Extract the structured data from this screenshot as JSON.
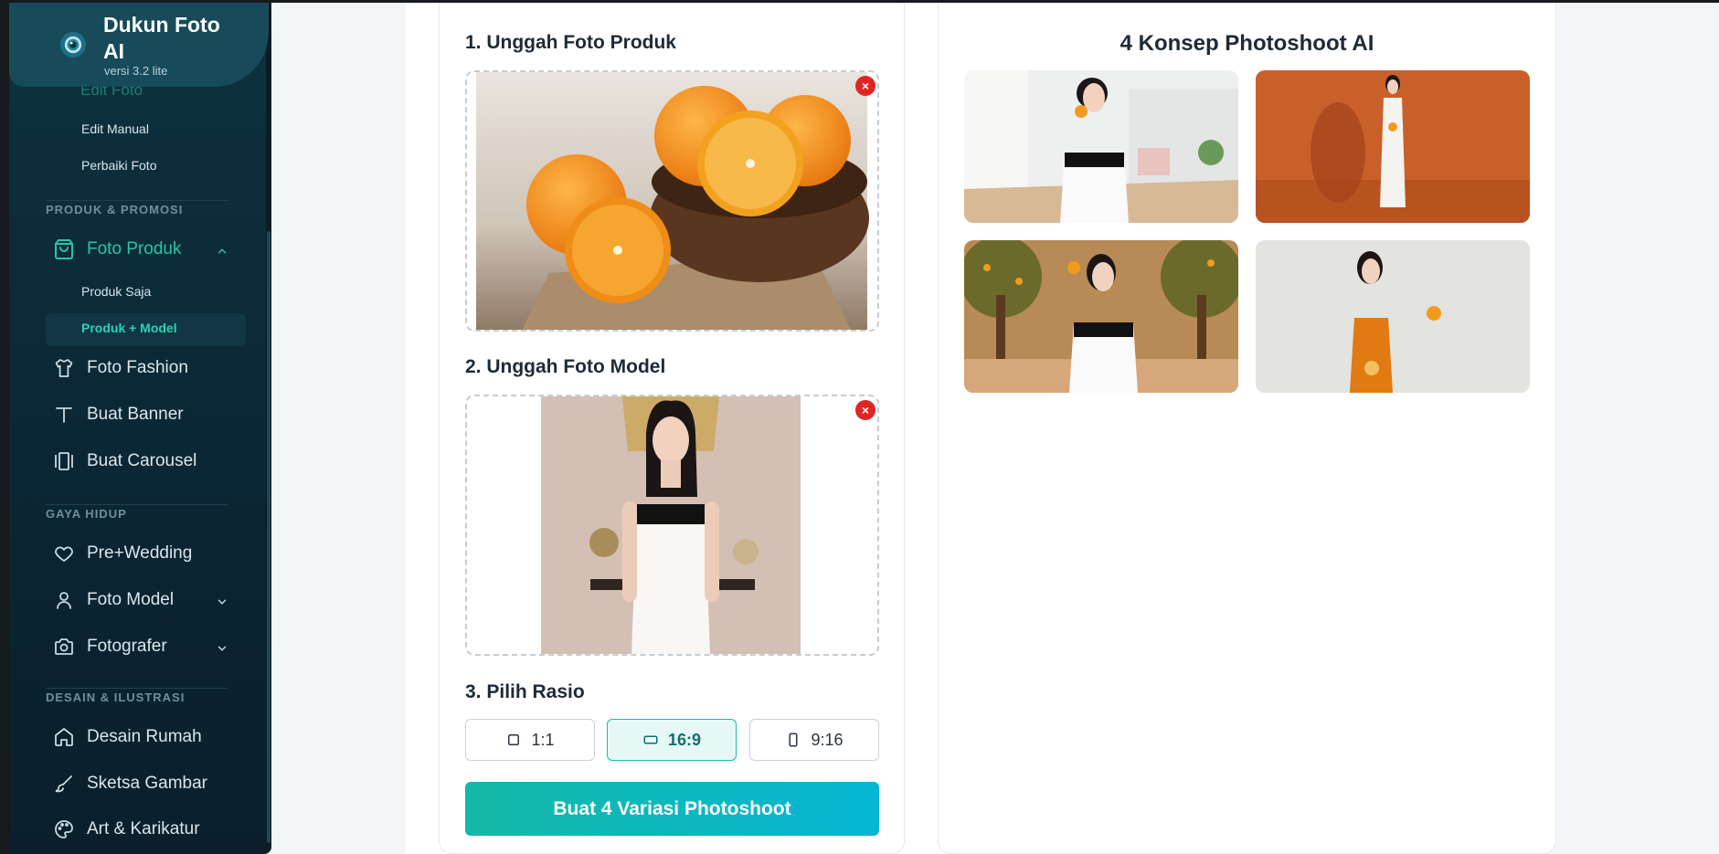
{
  "app": {
    "title": "Dukun Foto AI",
    "version": "versi 3.2 lite"
  },
  "sidebar": {
    "partial_item": "Edit Foto",
    "subs_top": [
      "Edit Manual",
      "Perbaiki Foto"
    ],
    "section_produk": "PRODUK & PROMOSI",
    "foto_produk": "Foto Produk",
    "foto_produk_subs": [
      "Produk Saja",
      "Produk + Model"
    ],
    "foto_fashion": "Foto Fashion",
    "buat_banner": "Buat Banner",
    "buat_carousel": "Buat Carousel",
    "section_gaya": "GAYA HIDUP",
    "prewedding": "Pre+Wedding",
    "foto_model": "Foto Model",
    "fotografer": "Fotografer",
    "section_desain": "DESAIN & ILUSTRASI",
    "desain_rumah": "Desain Rumah",
    "sketsa_gambar": "Sketsa Gambar",
    "art_karikatur": "Art & Karikatur"
  },
  "form": {
    "step1": "1. Unggah Foto Produk",
    "step2": "2. Unggah Foto Model",
    "step3": "3. Pilih Rasio",
    "remove_symbol": "×",
    "ratios": [
      "1:1",
      "16:9",
      "9:16"
    ],
    "selected_ratio": "16:9",
    "submit": "Buat 4 Variasi Photoshoot"
  },
  "results": {
    "title": "4 Konsep Photoshoot AI"
  },
  "colors": {
    "accent": "#14b8a6",
    "accent_end": "#06b6d4",
    "danger": "#e02424",
    "sidebar_bg": "#0b2533"
  },
  "icons": [
    "camera-lens-icon",
    "shopping-bag-icon",
    "chevron-up-icon",
    "shirt-icon",
    "text-t-icon",
    "carousel-icon",
    "heart-icon",
    "user-icon",
    "chevron-down-icon",
    "camera-icon",
    "house-icon",
    "brush-icon",
    "palette-icon",
    "square-icon",
    "landscape-icon",
    "portrait-icon",
    "close-icon"
  ]
}
